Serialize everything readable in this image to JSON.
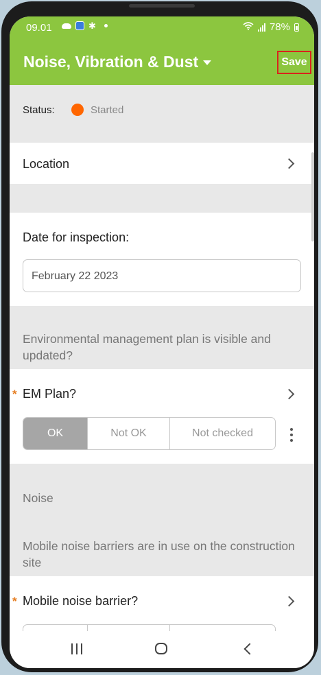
{
  "status_bar": {
    "time": "09.01",
    "battery": "78%"
  },
  "header": {
    "title": "Noise, Vibration & Dust",
    "save_label": "Save",
    "accent_color": "#8cc63f"
  },
  "status": {
    "label": "Status:",
    "value": "Started",
    "dot_color": "#ff6600"
  },
  "location": {
    "label": "Location"
  },
  "inspection_date": {
    "label": "Date for inspection:",
    "value": "February 22 2023"
  },
  "em_section": {
    "question": "Environmental management plan is visible and updated?",
    "item_label": "EM Plan?",
    "required": "*",
    "options": [
      "OK",
      "Not OK",
      "Not checked"
    ],
    "selected": "OK"
  },
  "noise_section": {
    "title": "Noise",
    "question": "Mobile noise barriers are in use on the construction site",
    "item_label": "Mobile noise barrier?",
    "required": "*"
  }
}
